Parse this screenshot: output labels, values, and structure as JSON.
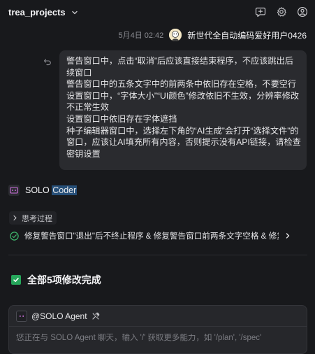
{
  "header": {
    "project_name": "trea_projects"
  },
  "message": {
    "timestamp": "5月4日 02:42",
    "user_name": "新世代全自动编码爱好用户0426",
    "lines": [
      "警告窗口中，点击“取消”后应该直接结束程序，不应该跳出后续窗口",
      "警告窗口中的五条文字中的前两条中依旧存在空格，不要空行",
      "设置窗口中，“字体大小”“UI颜色”修改依旧不生效，分辨率修改不正常生效",
      "设置窗口中依旧存在字体遮挡",
      "种子编辑器窗口中，选择左下角的“AI生成”会打开“选择文件”的窗口，应该让AI填充所有内容，否则提示没有API链接，请检查密钥设置"
    ]
  },
  "agent_response": {
    "name_part1": "SOLO ",
    "name_part2": "Coder",
    "thinking_label": "思考过程",
    "task_summary": "修复警告窗口\"退出\"后不终止程序 & 修复警告窗口前两条文字空格 & 修复设置...",
    "completion_title": "全部5项修改完成"
  },
  "composer": {
    "agent_tag": "@SOLO Agent",
    "placeholder": "您正在与 SOLO Agent 聊天，输入 '/' 获取更多能力，如 '/plan', '/spec'"
  },
  "icons": {
    "chevron": "chevron-down-icon",
    "new_chat": "new-chat-icon",
    "settings": "gear-icon",
    "account": "user-icon",
    "undo": "undo-icon",
    "expand": "chevron-right-icon",
    "task_status": "check-circle-icon",
    "done": "checkbox-checked-icon",
    "tools": "tools-icon"
  },
  "colors": {
    "background": "#18191c",
    "bubble": "#2a2b2f",
    "success": "#26a65b",
    "highlight": "#264f78"
  }
}
